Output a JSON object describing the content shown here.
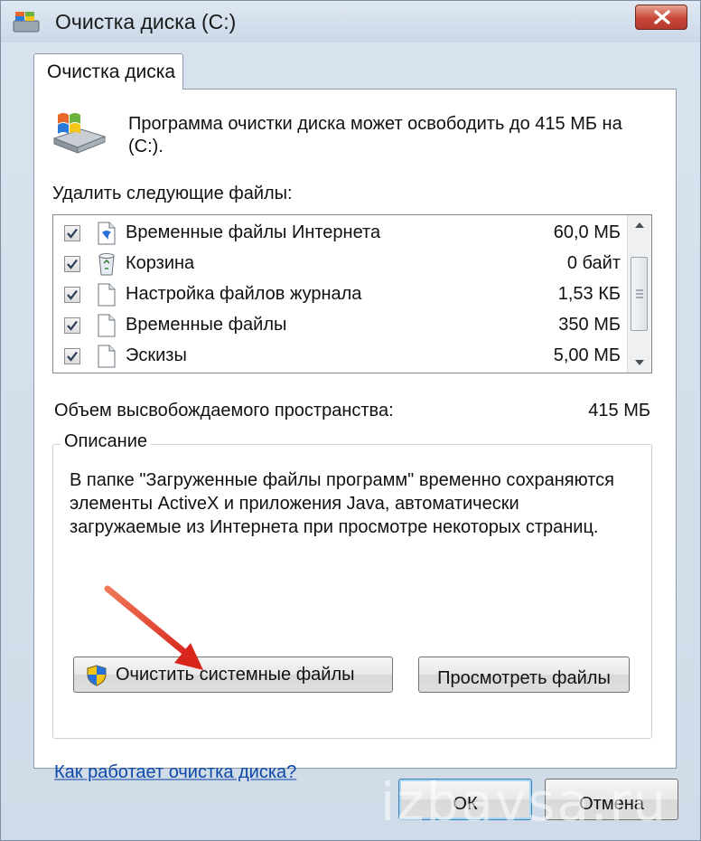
{
  "window": {
    "title": "Очистка диска  (C:)"
  },
  "tab": {
    "label": "Очистка диска"
  },
  "header": {
    "text": "Программа очистки диска может освободить до 415 МБ на  (C:)."
  },
  "files": {
    "label": "Удалить следующие файлы:",
    "items": [
      {
        "name": "Временные файлы Интернета",
        "size": "60,0 МБ",
        "checked": true,
        "icon": "internet-files-icon"
      },
      {
        "name": "Корзина",
        "size": "0 байт",
        "checked": true,
        "icon": "recycle-bin-icon"
      },
      {
        "name": "Настройка файлов журнала",
        "size": "1,53 КБ",
        "checked": true,
        "icon": "document-icon"
      },
      {
        "name": "Временные файлы",
        "size": "350 МБ",
        "checked": true,
        "icon": "document-icon"
      },
      {
        "name": "Эскизы",
        "size": "5,00 МБ",
        "checked": true,
        "icon": "document-icon"
      }
    ]
  },
  "space": {
    "label": "Объем высвобождаемого пространства:",
    "value": "415 МБ"
  },
  "description": {
    "title": "Описание",
    "text": "В папке \"Загруженные файлы программ\" временно сохраняются элементы ActiveX и приложения Java, автоматически загружаемые из Интернета при просмотре некоторых страниц."
  },
  "buttons": {
    "clean_system": "Очистить системные файлы",
    "view_files": "Просмотреть файлы",
    "ok": "ОК",
    "cancel": "Отмена"
  },
  "help_link": "Как работает очистка диска?",
  "watermark": "izbavsa.ru",
  "colors": {
    "link": "#0e49a8",
    "close_button": "#c8463a",
    "arrow": "#d9261c"
  }
}
